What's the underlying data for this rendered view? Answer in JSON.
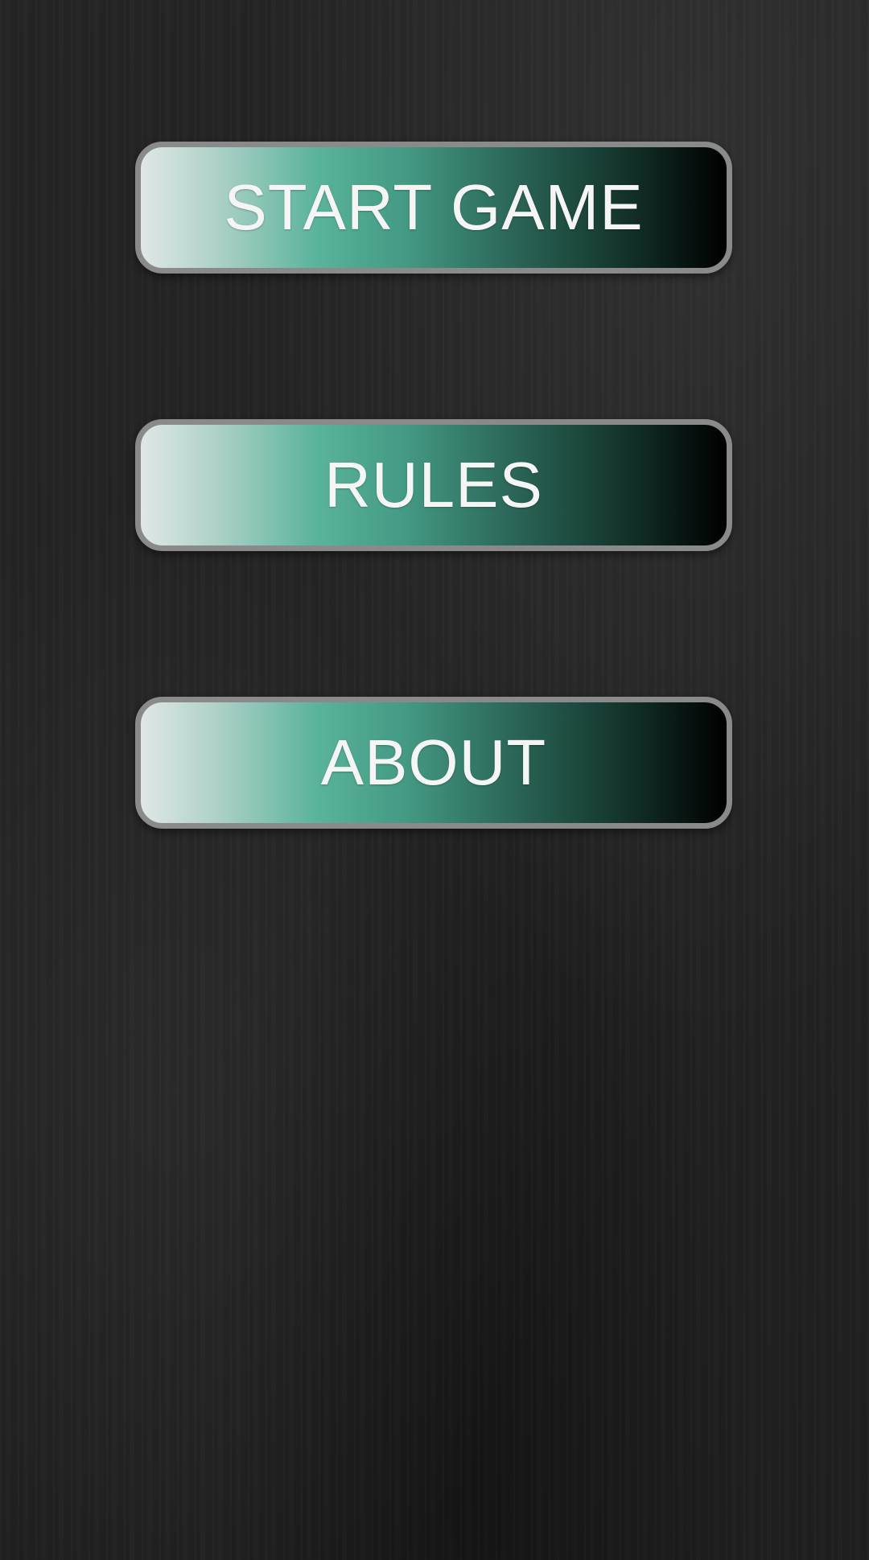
{
  "main_menu": {
    "buttons": [
      {
        "label": "START GAME"
      },
      {
        "label": "RULES"
      },
      {
        "label": "ABOUT"
      }
    ]
  },
  "colors": {
    "background": "#222222",
    "button_border": "#8a8a8a",
    "button_gradient_start": "#e1e7e6",
    "button_gradient_mid": "#5ab39b",
    "button_gradient_end": "#000000",
    "button_text": "#f5f5f5"
  }
}
